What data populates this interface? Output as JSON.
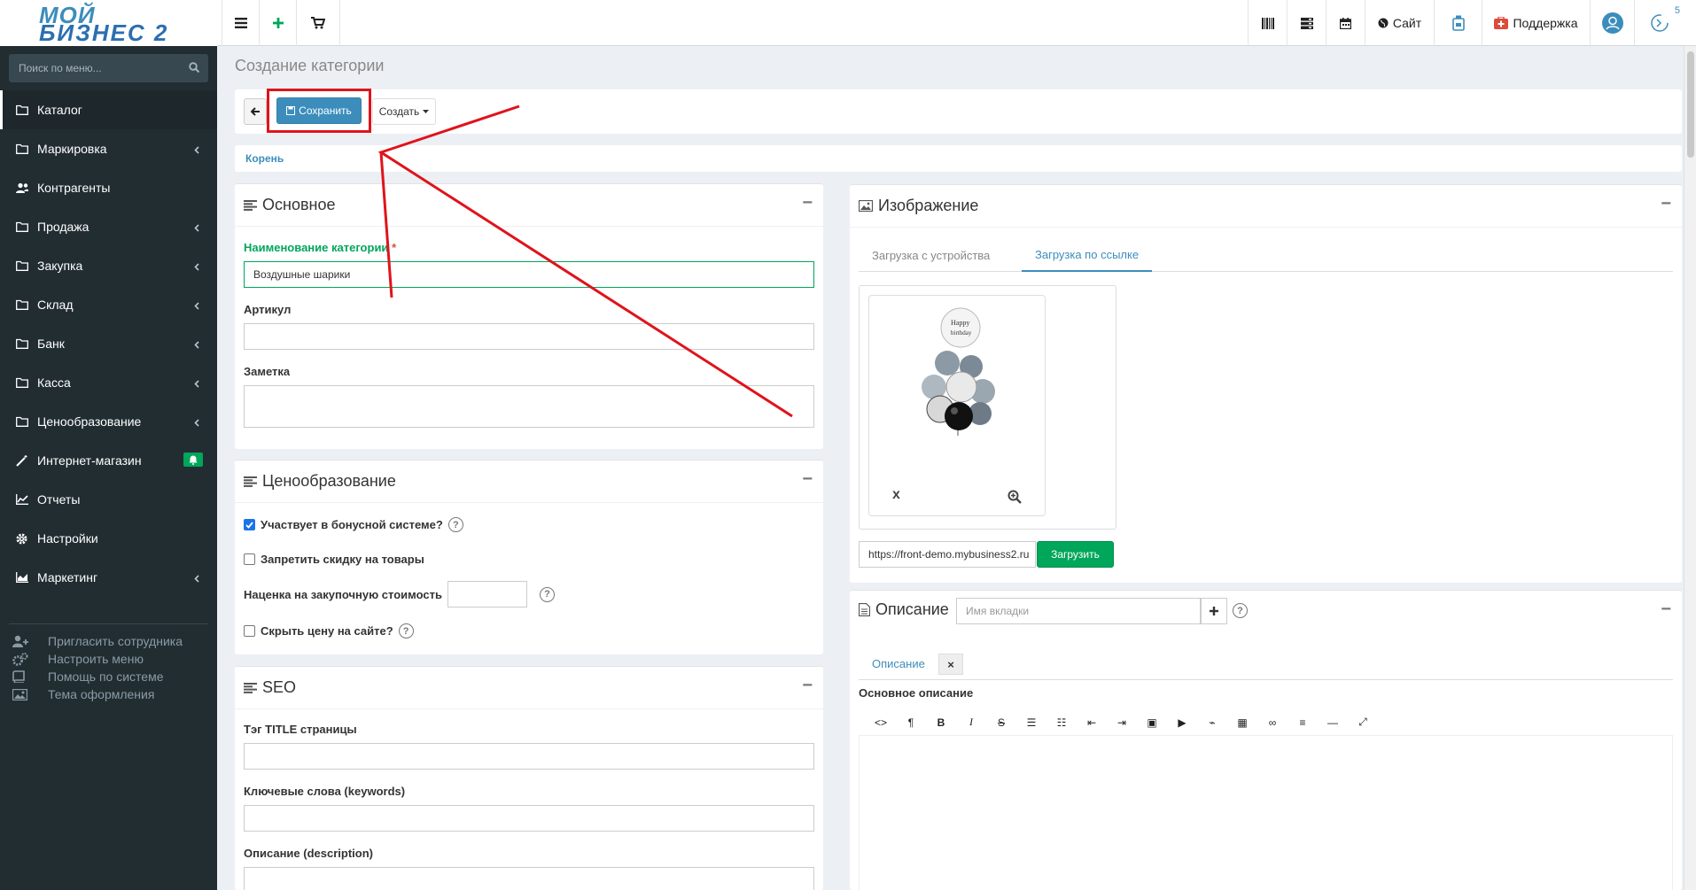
{
  "app": {
    "logo_line1": "МОЙ",
    "logo_line2": "БИЗНЕС 2",
    "notify_count": "5"
  },
  "topbar": {
    "site_label": "Сайт",
    "support_label": "Поддержка"
  },
  "sidebar": {
    "search_placeholder": "Поиск по меню...",
    "items": [
      {
        "label": "Каталог",
        "icon": "folder-icon",
        "active": true,
        "submenu": false
      },
      {
        "label": "Маркировка",
        "icon": "folder-icon",
        "submenu": true
      },
      {
        "label": "Контрагенты",
        "icon": "users-icon",
        "submenu": false
      },
      {
        "label": "Продажа",
        "icon": "folder-icon",
        "submenu": true
      },
      {
        "label": "Закупка",
        "icon": "folder-icon",
        "submenu": true
      },
      {
        "label": "Склад",
        "icon": "folder-icon",
        "submenu": true
      },
      {
        "label": "Банк",
        "icon": "folder-icon",
        "submenu": true
      },
      {
        "label": "Касса",
        "icon": "folder-icon",
        "submenu": true
      },
      {
        "label": "Ценообразование",
        "icon": "folder-icon",
        "submenu": true
      },
      {
        "label": "Интернет-магазин",
        "icon": "magic-wand-icon",
        "submenu": false
      },
      {
        "label": "Отчеты",
        "icon": "line-chart-icon",
        "submenu": false
      },
      {
        "label": "Настройки",
        "icon": "gear-icon",
        "submenu": false
      },
      {
        "label": "Маркетинг",
        "icon": "area-chart-icon",
        "submenu": true
      }
    ],
    "extra": [
      {
        "label": "Пригласить сотрудника",
        "icon": "user-plus-icon"
      },
      {
        "label": "Настроить меню",
        "icon": "gears-icon"
      },
      {
        "label": "Помощь по системе",
        "icon": "book-icon"
      },
      {
        "label": "Тема оформления",
        "icon": "picture-icon"
      }
    ]
  },
  "page": {
    "title": "Создание категории",
    "save_label": "Сохранить",
    "create_label": "Создать",
    "breadcrumb": "Корень"
  },
  "basic": {
    "title": "Основное",
    "name_label": "Наименование категории",
    "name_required": "*",
    "name_value": "Воздушные шарики",
    "article_label": "Артикул",
    "note_label": "Заметка"
  },
  "pricing": {
    "title": "Ценообразование",
    "bonus_label": "Участвует в бонусной системе?",
    "bonus_checked": true,
    "no_discount_label": "Запретить скидку на товары",
    "markup_label": "Наценка на закупочную стоимость",
    "hide_price_label": "Скрыть цену на сайте?"
  },
  "seo": {
    "title": "SEO",
    "title_tag_label": "Тэг TITLE страницы",
    "keywords_label": "Ключевые слова (keywords)",
    "description_label": "Описание (description)"
  },
  "image": {
    "title": "Изображение",
    "tab_device": "Загрузка с устройства",
    "tab_link": "Загрузка по ссылке",
    "url_value": "https://front-demo.mybusiness2.ru",
    "upload_label": "Загрузить",
    "delete_label": "x"
  },
  "description": {
    "title": "Описание",
    "tab_name_placeholder": "Имя вкладки",
    "tab_label": "Описание",
    "tab_close": "×",
    "editor_heading": "Основное описание"
  },
  "colors": {
    "sidebar_bg": "#222d32",
    "primary": "#3c8dbc",
    "success": "#00a65a",
    "annotation": "#e0131b"
  }
}
